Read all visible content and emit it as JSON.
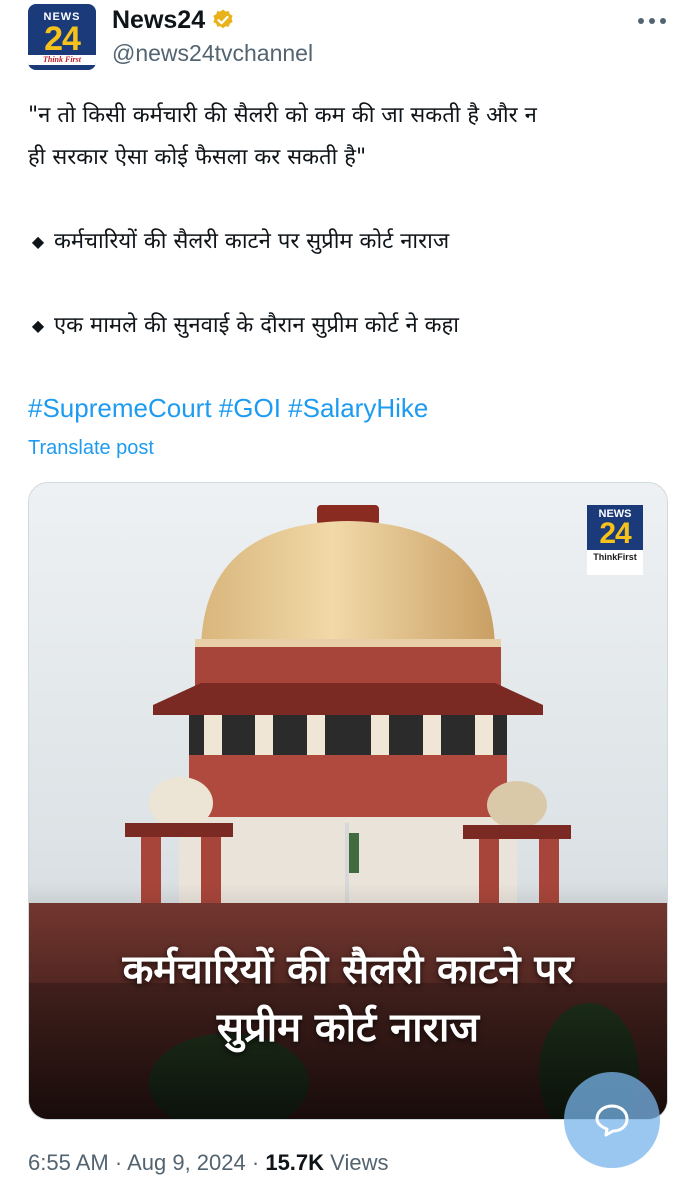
{
  "author": {
    "display_name": "News24",
    "handle": "@news24tvchannel",
    "avatar_logo_top": "NEWS",
    "avatar_logo_number": "24",
    "avatar_logo_tagline": "Think First",
    "verified_color": "#e8b21c"
  },
  "tweet": {
    "quote_line_1": "\"न तो किसी कर्मचारी की सैलरी को कम की जा सकती है और न",
    "quote_line_2": "ही सरकार ऐसा कोई फैसला कर सकती है\"",
    "bullets": [
      {
        "icon": "diamond-icon",
        "text": "कर्मचारियों की सैलरी काटने पर सुप्रीम कोर्ट नाराज"
      },
      {
        "icon": "diamond-icon",
        "text": "एक मामले की सुनवाई के दौरान सुप्रीम कोर्ट ने कहा"
      }
    ],
    "hashtags": [
      "#SupremeCourt",
      "#GOI",
      "#SalaryHike"
    ],
    "translate_label": "Translate post"
  },
  "media": {
    "logo_top": "NEWS",
    "logo_number": "24",
    "logo_tagline": "ThinkFirst",
    "caption_line_1": "कर्मचारियों की सैलरी काटने पर",
    "caption_line_2": "सुप्रीम कोर्ट नाराज"
  },
  "meta": {
    "time": "6:55 AM",
    "separator": "·",
    "date": "Aug 9, 2024",
    "views_count": "15.7K",
    "views_label": "Views"
  },
  "colors": {
    "link": "#1d9bf0",
    "secondary_text": "#536471",
    "primary_text": "#0f1419",
    "fab": "#78b4eb"
  }
}
